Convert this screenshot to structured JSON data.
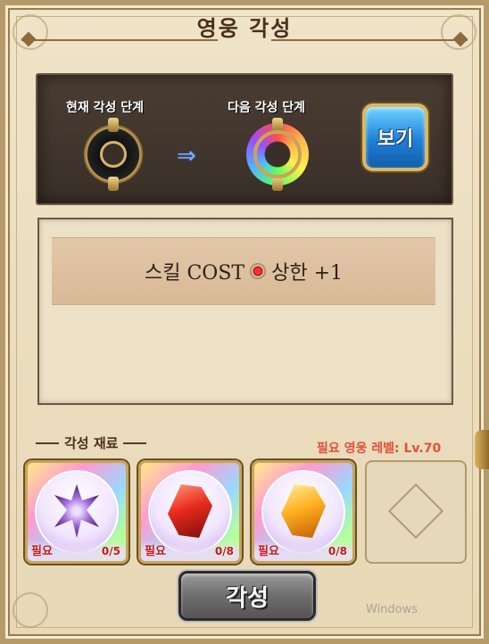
{
  "title": "영웅 각성",
  "stage": {
    "current_label": "현재 각성 단계",
    "next_label": "다음 각성 단계",
    "arrow": "⇒",
    "view_button": "보기"
  },
  "description": {
    "prefix": "스킬 COST",
    "suffix": "상한 +1"
  },
  "materials": {
    "header": "각성 재료",
    "required_level": "필요 영웅 레벨: Lv.70",
    "slots": [
      {
        "need_label": "필요",
        "count": "0/5",
        "gem": "purple-star-gem-icon"
      },
      {
        "need_label": "필요",
        "count": "0/8",
        "gem": "red-crystal-icon"
      },
      {
        "need_label": "필요",
        "count": "0/8",
        "gem": "orange-crystal-icon"
      }
    ]
  },
  "awaken_button": "각성",
  "watermark": "Windows"
}
